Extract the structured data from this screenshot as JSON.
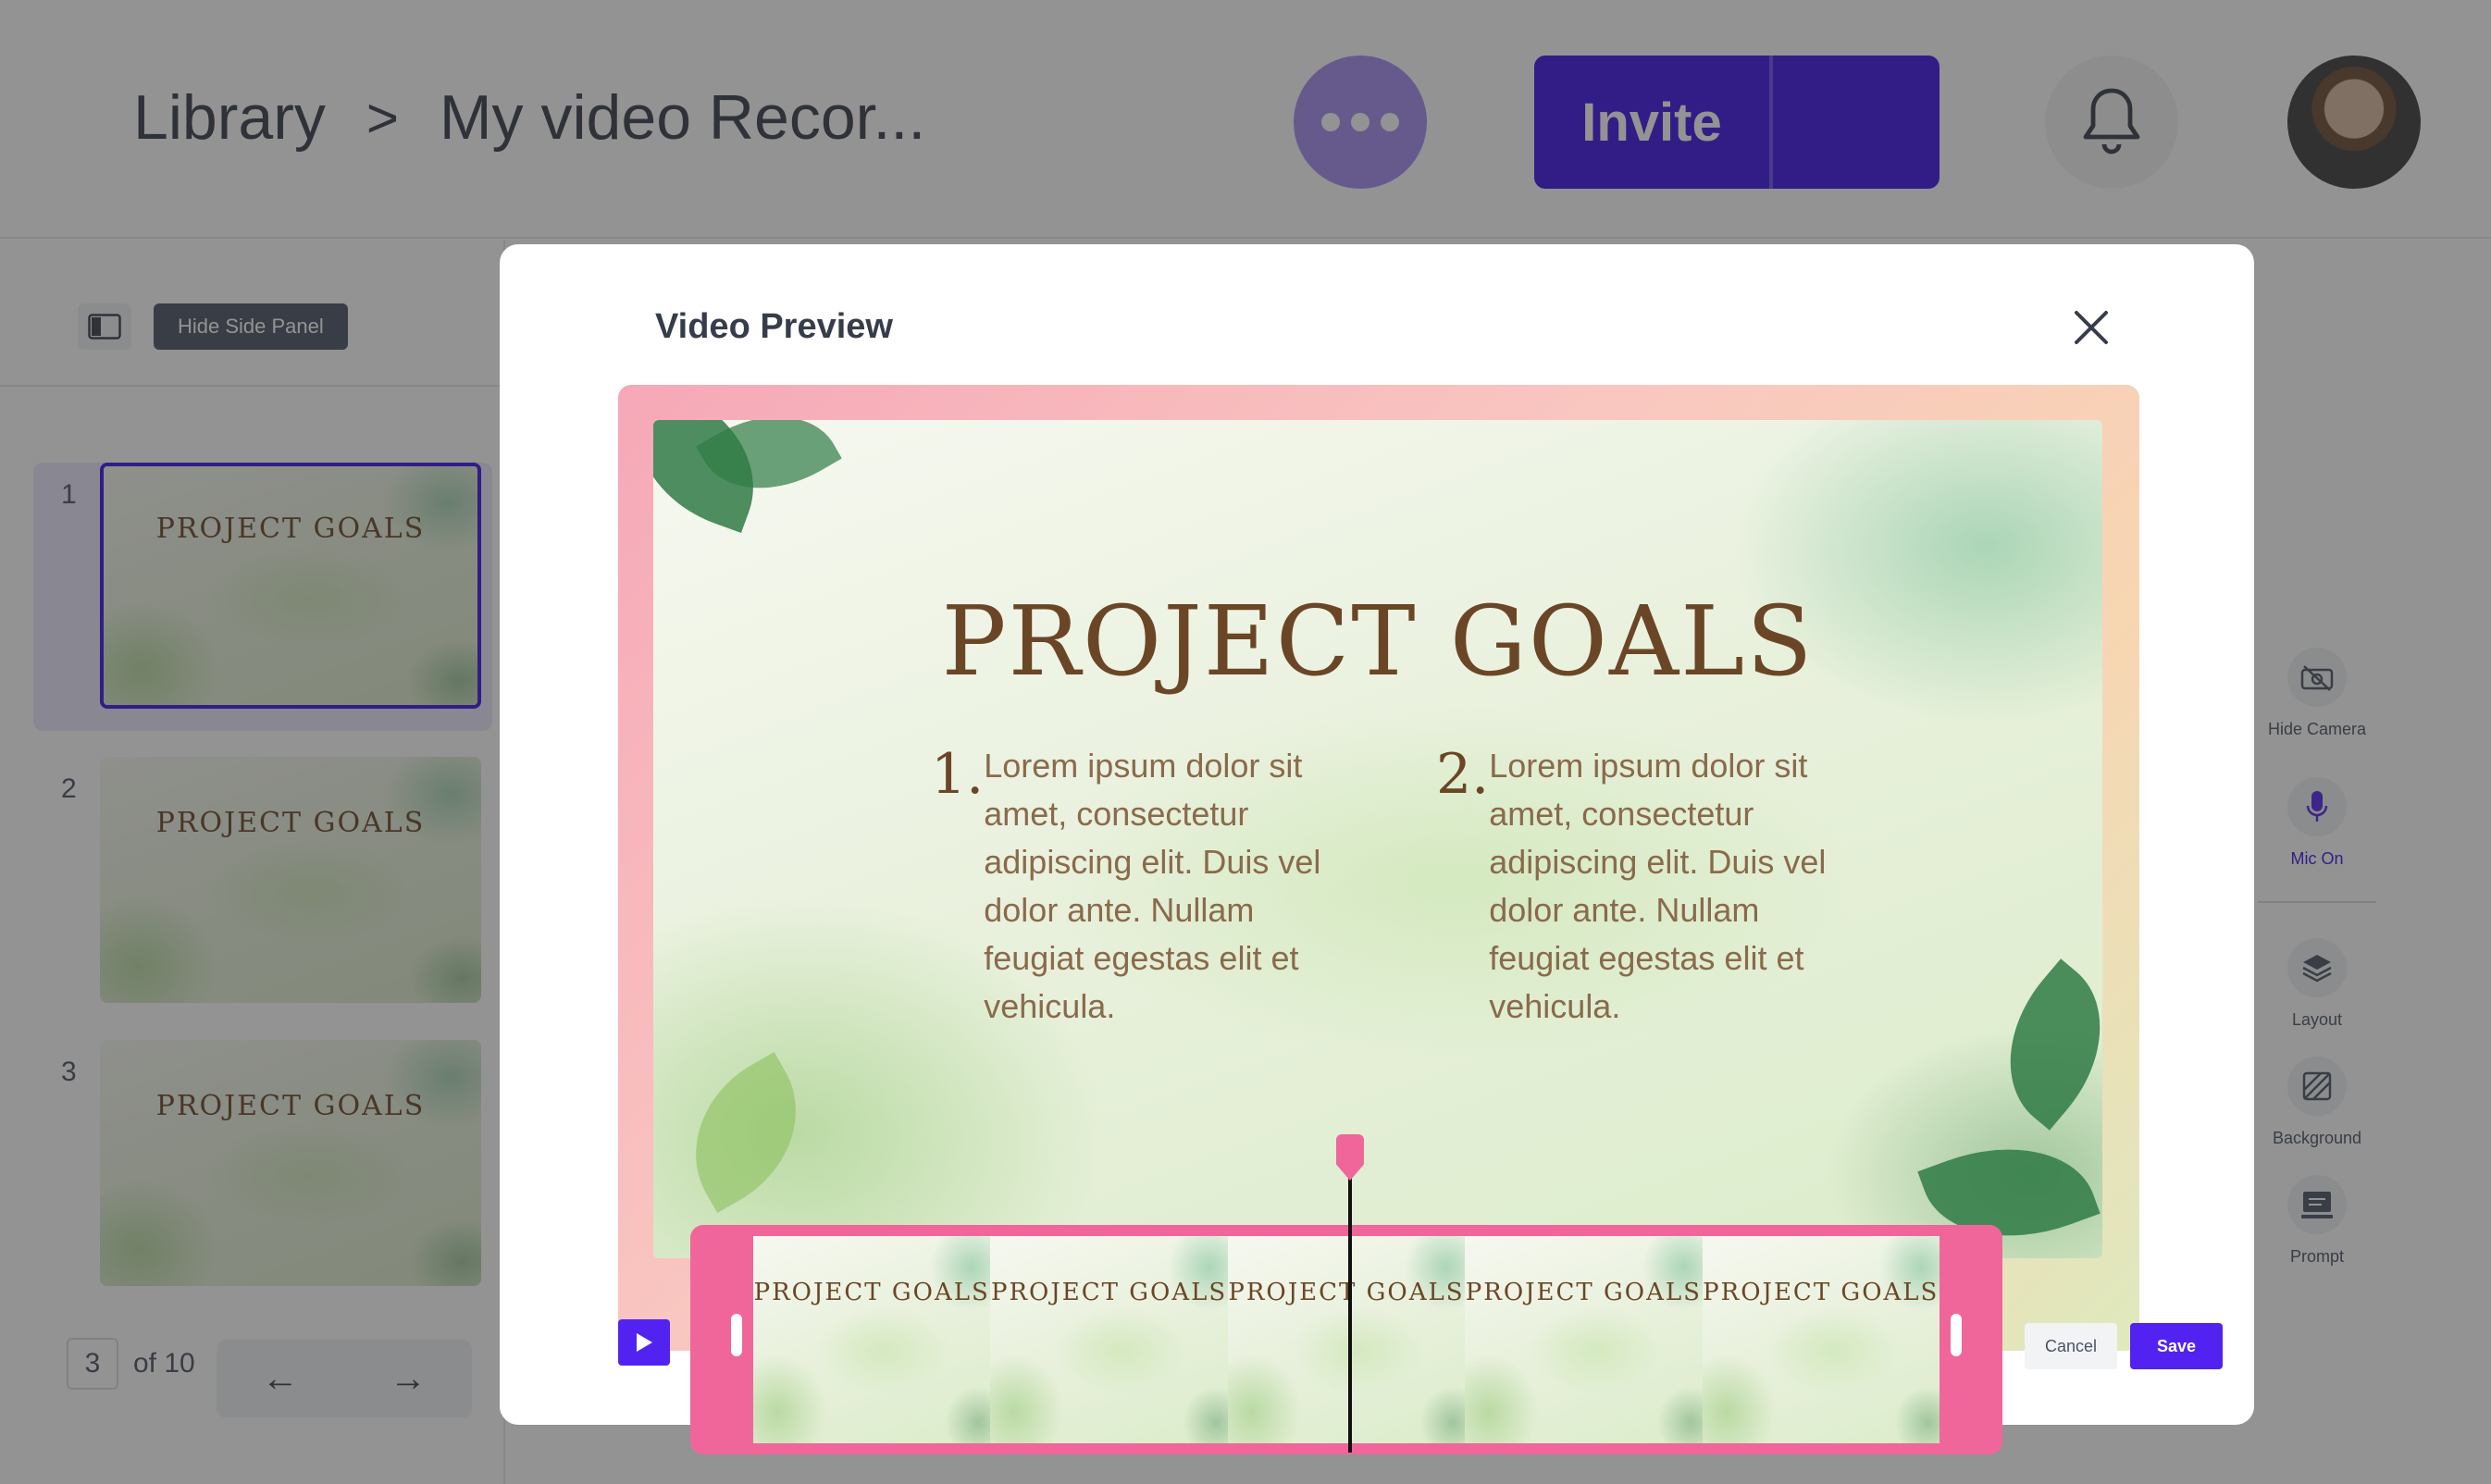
{
  "header": {
    "breadcrumb_root": "Library",
    "breadcrumb_sep": ">",
    "breadcrumb_current": "My video Recor...",
    "invite_label": "Invite",
    "more_icon": "more-horizontal-icon",
    "bell_icon": "bell-icon"
  },
  "sidebar": {
    "toggle_tooltip": "Hide Side Panel",
    "slides": [
      {
        "number": "1",
        "title": "PROJECT GOALS"
      },
      {
        "number": "2",
        "title": "PROJECT GOALS"
      },
      {
        "number": "3",
        "title": "PROJECT GOALS"
      }
    ],
    "pager": {
      "current": "3",
      "of_label": "of 10",
      "prev_icon": "←",
      "next_icon": "→"
    }
  },
  "right_toolbar": {
    "hide_camera": "Hide Camera",
    "mic_on": "Mic On",
    "layout": "Layout",
    "background": "Background",
    "prompt": "Prompt"
  },
  "modal": {
    "title": "Video Preview",
    "cancel_label": "Cancel",
    "save_label": "Save"
  },
  "slide": {
    "title": "PROJECT GOALS",
    "col1_num": "1.",
    "col1_text": "Lorem ipsum dolor sit amet, consectetur adipiscing elit. Duis vel dolor ante. Nullam feugiat egestas elit et vehicula.",
    "col2_num": "2.",
    "col2_text": "Lorem ipsum dolor sit amet, consectetur adipiscing elit. Duis vel dolor ante. Nullam feugiat egestas elit et vehicula."
  },
  "timeline": {
    "frames": [
      {
        "title": "PROJECT GOALS"
      },
      {
        "title": "PROJECT GOALS"
      },
      {
        "title": "PROJECT GOALS"
      },
      {
        "title": "PROJECT GOALS"
      },
      {
        "title": "PROJECT GOALS"
      }
    ]
  },
  "colors": {
    "brand": "#3d13e6",
    "timeline": "#f0669b",
    "slide_title": "#6b4626"
  }
}
